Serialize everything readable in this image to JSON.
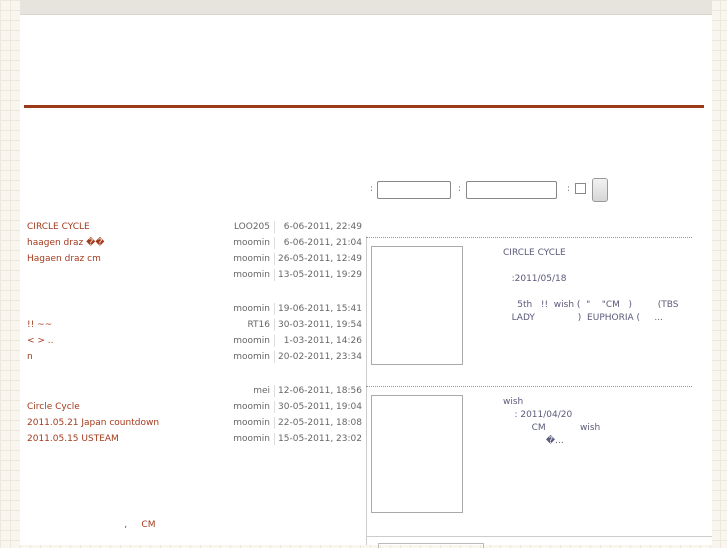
{
  "search": {
    "label1": ":",
    "label2": ":",
    "label3": ":"
  },
  "posts": [
    {
      "title": "CIRCLE CYCLE",
      "author": "LOO205",
      "date": "6-06-2011, 22:49"
    },
    {
      "title": "      haagen draz        ��",
      "author": "moomin",
      "date": "6-06-2011, 21:04"
    },
    {
      "title": "         Hagaen draz cm",
      "author": "moomin",
      "date": "26-05-2011, 12:49"
    },
    {
      "title": "",
      "author": "moomin",
      "date": "13-05-2011, 19:29"
    },
    {
      "title": "",
      "author": "moomin",
      "date": "19-06-2011, 15:41"
    },
    {
      "title": "   !!     ~~",
      "author": "RT16",
      "date": "30-03-2011, 19:54"
    },
    {
      "title": "<   >       ..",
      "author": "moomin",
      "date": "1-03-2011, 14:26"
    },
    {
      "title": "     n",
      "author": "moomin",
      "date": "20-02-2011, 23:34"
    },
    {
      "title": "",
      "author": "mei",
      "date": "12-06-2011, 18:56"
    },
    {
      "title": "    Circle Cycle",
      "author": "moomin",
      "date": "30-05-2011, 19:04"
    },
    {
      "title": "2011.05.21 Japan countdown",
      "author": "moomin",
      "date": "22-05-2011, 18:08"
    },
    {
      "title": "2011.05.15   USTEAM",
      "author": "moomin",
      "date": "15-05-2011, 23:02"
    }
  ],
  "footer_text": "                                  ,     CM",
  "entries": [
    {
      "text": "CIRCLE CYCLE\n\n   :2011/05/18\n\n     5th   !!  wish (  \"    \"CM   )         (TBS\n   LADY               )  EUPHORIA (     ..."
    },
    {
      "text": "wish\n    : 2011/04/20\n          CM            wish\n               �..."
    }
  ]
}
